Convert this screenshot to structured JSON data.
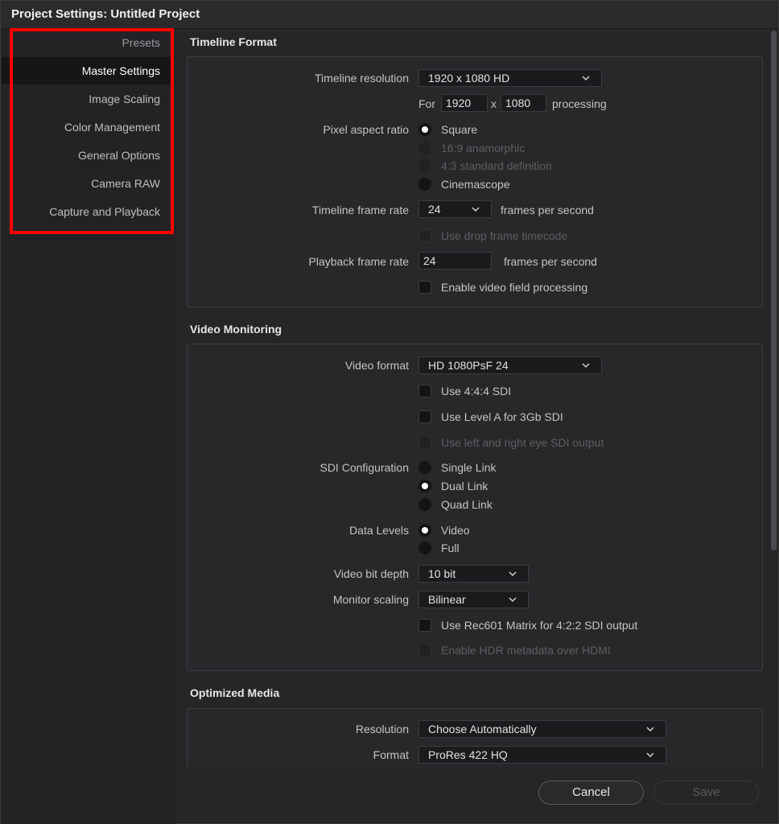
{
  "window": {
    "title": "Project Settings:  Untitled Project"
  },
  "sidebar": {
    "items": [
      {
        "label": "Presets"
      },
      {
        "label": "Master Settings"
      },
      {
        "label": "Image Scaling"
      },
      {
        "label": "Color Management"
      },
      {
        "label": "General Options"
      },
      {
        "label": "Camera RAW"
      },
      {
        "label": "Capture and Playback"
      }
    ],
    "active_index": 1
  },
  "timeline_format": {
    "title": "Timeline Format",
    "resolution_label": "Timeline resolution",
    "resolution_value": "1920 x 1080 HD",
    "for_label": "For",
    "width": "1920",
    "x_label": "x",
    "height": "1080",
    "processing_label": "processing",
    "pixel_aspect_label": "Pixel aspect ratio",
    "pixel_aspect_options": [
      "Square",
      "16:9 anamorphic",
      "4:3 standard definition",
      "Cinemascope"
    ],
    "pixel_aspect_selected": "Square",
    "frame_rate_label": "Timeline frame rate",
    "frame_rate_value": "24",
    "fps_label": "frames per second",
    "drop_frame_label": "Use drop frame timecode",
    "playback_rate_label": "Playback frame rate",
    "playback_rate_value": "24",
    "playback_fps_label": "frames per second",
    "field_processing_label": "Enable video field processing"
  },
  "video_monitoring": {
    "title": "Video Monitoring",
    "video_format_label": "Video format",
    "video_format_value": "HD 1080PsF 24",
    "use_444_label": "Use 4:4:4 SDI",
    "level_a_label": "Use Level A for 3Gb SDI",
    "stereo_label": "Use left and right eye SDI output",
    "sdi_config_label": "SDI Configuration",
    "sdi_options": [
      "Single Link",
      "Dual Link",
      "Quad Link"
    ],
    "sdi_selected": "Dual Link",
    "data_levels_label": "Data Levels",
    "data_levels_options": [
      "Video",
      "Full"
    ],
    "data_levels_selected": "Video",
    "bit_depth_label": "Video bit depth",
    "bit_depth_value": "10 bit",
    "monitor_scaling_label": "Monitor scaling",
    "monitor_scaling_value": "Bilinear",
    "rec601_label": "Use Rec601 Matrix for 4:2:2 SDI output",
    "hdr_label": "Enable HDR metadata over HDMI"
  },
  "optimized_media": {
    "title": "Optimized Media",
    "resolution_label": "Resolution",
    "resolution_value": "Choose Automatically",
    "format_label": "Format",
    "format_value": "ProRes 422 HQ"
  },
  "footer": {
    "cancel_label": "Cancel",
    "save_label": "Save"
  },
  "colors": {
    "highlight": "#ff0000",
    "background": "#262628",
    "sidebar_active": "#161618"
  }
}
